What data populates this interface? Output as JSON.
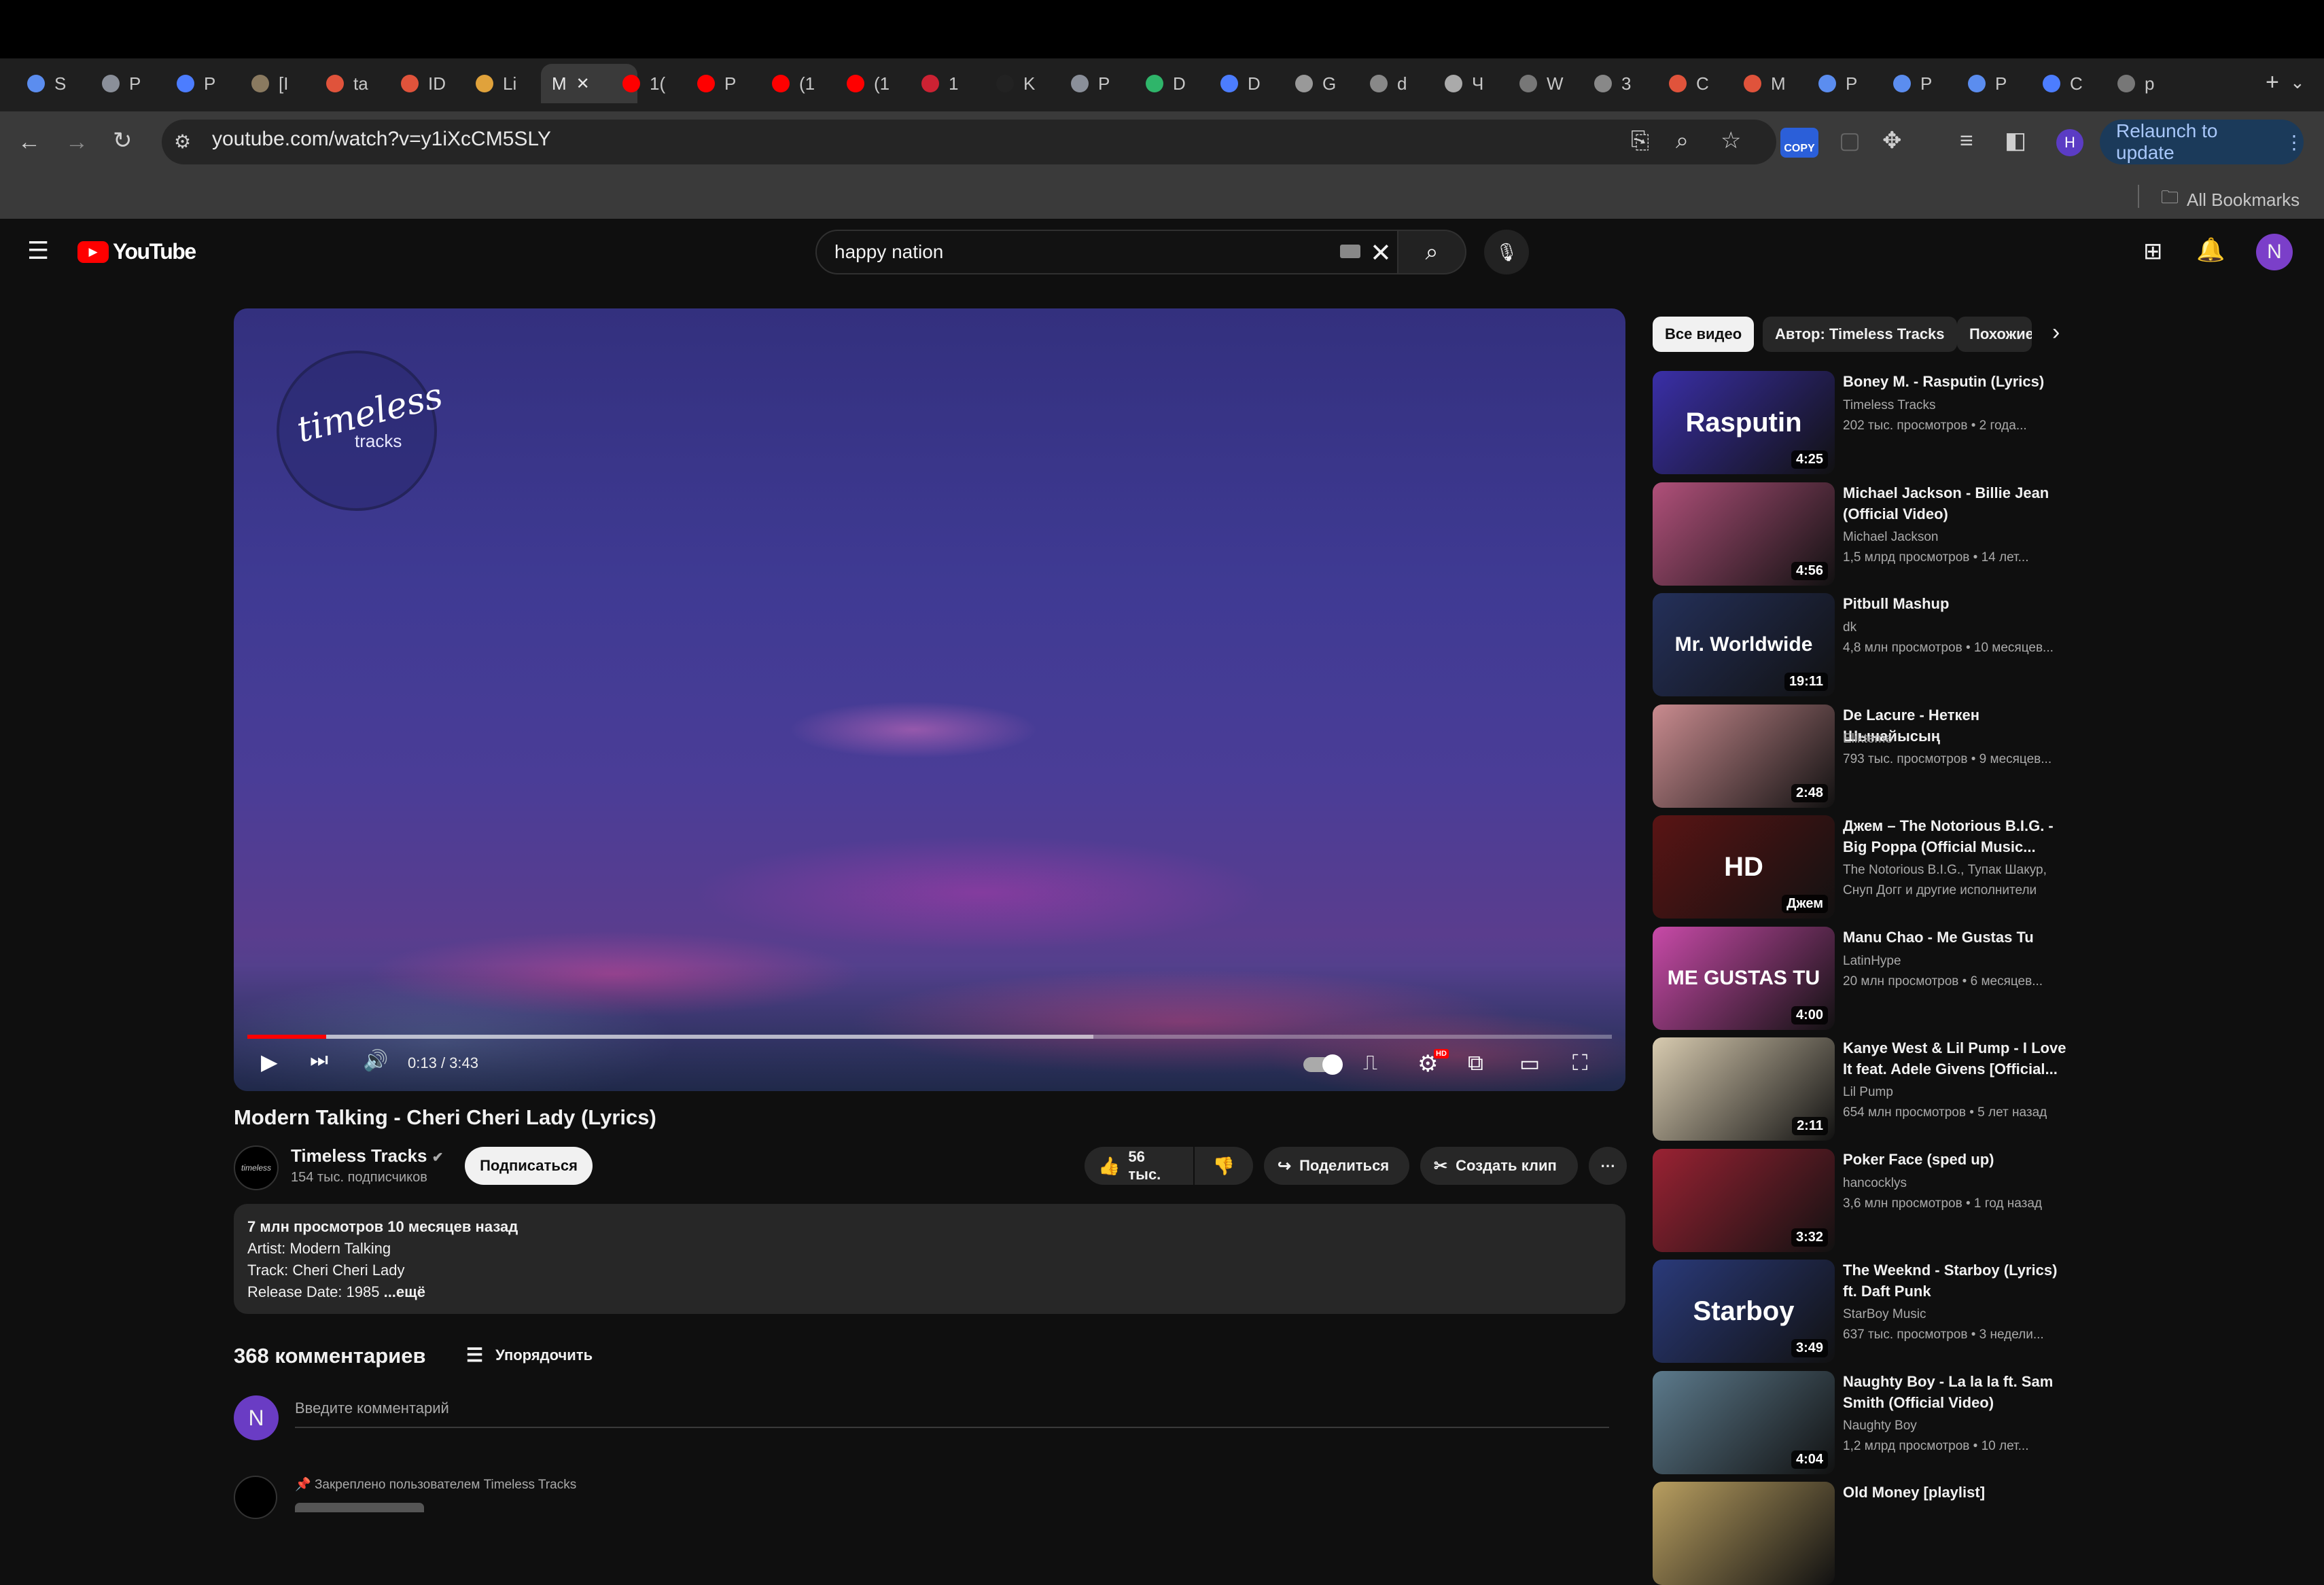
{
  "browser": {
    "tabs": [
      {
        "label": "S"
      },
      {
        "label": "P"
      },
      {
        "label": "P"
      },
      {
        "label": "[I"
      },
      {
        "label": "ta"
      },
      {
        "label": "ID"
      },
      {
        "label": "Li"
      },
      {
        "label": "M"
      },
      {
        "label": "1("
      },
      {
        "label": "P"
      },
      {
        "label": "(1"
      },
      {
        "label": "(1"
      },
      {
        "label": "1"
      },
      {
        "label": "K"
      },
      {
        "label": "P"
      },
      {
        "label": "D"
      },
      {
        "label": "D"
      },
      {
        "label": "G"
      },
      {
        "label": "d"
      },
      {
        "label": "Ч"
      },
      {
        "label": "W"
      },
      {
        "label": "3"
      },
      {
        "label": "C"
      },
      {
        "label": "M"
      },
      {
        "label": "P"
      },
      {
        "label": "P"
      },
      {
        "label": "P"
      },
      {
        "label": "C"
      },
      {
        "label": "p"
      }
    ],
    "url": "youtube.com/watch?v=y1iXcCM5SLY",
    "relaunch_label": "Relaunch to update",
    "profile_initial": "H",
    "copy_badge": "COPY",
    "all_bookmarks": "All Bookmarks"
  },
  "youtube": {
    "logo_text": "YouTube",
    "search_value": "happy nation",
    "avatar_initial": "N"
  },
  "player": {
    "overlay_logo_main": "timeless",
    "overlay_logo_sub": "tracks",
    "time_current": "0:13",
    "time_total": "3:43",
    "played_fraction": 0.058,
    "buffered_fraction": 0.62,
    "hd_badge": "HD"
  },
  "video": {
    "title": "Modern Talking - Cheri Cheri Lady (Lyrics)",
    "channel": "Timeless Tracks",
    "subscribers": "154 тыс. подписчиков",
    "subscribe_label": "Подписаться",
    "likes": "56 тыс.",
    "share_label": "Поделиться",
    "clip_label": "Создать клип",
    "desc_stats": "7 млн просмотров  10 месяцев назад",
    "desc_lines": [
      "Artist: Modern Talking",
      "Track: Cheri Cheri Lady",
      "Release Date: 1985"
    ],
    "desc_more": " ...ещё"
  },
  "comments": {
    "count_label": "368 комментариев",
    "sort_label": "Упорядочить",
    "input_placeholder": "Введите комментарий",
    "user_initial": "N",
    "pinned_label": "Закреплено пользователем Timeless Tracks"
  },
  "sidebar": {
    "chips": [
      "Все видео",
      "Автор: Timeless Tracks",
      "Похожие"
    ],
    "recommendations": [
      {
        "title": "Boney M. - Rasputin (Lyrics)",
        "channel": "Timeless Tracks",
        "meta": "202 тыс. просмотров  • 2 года...",
        "duration": "4:25",
        "thumb_text": "Rasputin",
        "thumb_color": "#3a2fa8"
      },
      {
        "title": "Michael Jackson - Billie Jean (Official Video)",
        "channel": "Michael Jackson",
        "meta": "1,5 млрд просмотров  • 14 лет...",
        "duration": "4:56",
        "thumb_text": "",
        "thumb_color": "#b0507a"
      },
      {
        "title": "Pitbull Mashup",
        "channel": "dk",
        "meta": "4,8 млн просмотров  • 10 месяцев...",
        "duration": "19:11",
        "thumb_text": "Mr. Worldwide",
        "thumb_color": "#24305a"
      },
      {
        "title": "De Lacure - Неткен Шынайысың",
        "channel": "Elikteme",
        "meta": "793 тыс. просмотров  • 9 месяцев...",
        "duration": "2:48",
        "thumb_text": "",
        "thumb_color": "#c98b8f"
      },
      {
        "title": "Джем – The Notorious B.I.G. - Big Poppa (Official Music...",
        "channel": "The Notorious B.I.G., Тупак Шакур, Снуп Догг и другие исполнители",
        "meta": "",
        "duration": "Джем",
        "thumb_text": "HD",
        "thumb_color": "#5a1414"
      },
      {
        "title": "Manu Chao - Me Gustas Tu",
        "channel": "LatinHype",
        "meta": "20 млн просмотров  • 6 месяцев...",
        "duration": "4:00",
        "thumb_text": "ME GUSTAS TU",
        "thumb_color": "#c84aa8"
      },
      {
        "title": "Kanye West & Lil Pump - I Love It feat. Adele Givens [Official...",
        "channel": "Lil Pump",
        "meta": "654 млн просмотров  • 5 лет назад",
        "duration": "2:11",
        "thumb_text": "",
        "thumb_color": "#d8cbb0"
      },
      {
        "title": "Poker Face (sped up)",
        "channel": "hancocklys",
        "meta": "3,6 млн просмотров  • 1 год назад",
        "duration": "3:32",
        "thumb_text": "",
        "thumb_color": "#9a2233"
      },
      {
        "title": "The Weeknd - Starboy (Lyrics) ft. Daft Punk",
        "channel": "StarBoy Music",
        "meta": "637 тыс. просмотров  • 3 недели...",
        "duration": "3:49",
        "thumb_text": "Starboy",
        "thumb_color": "#2a3a7a"
      },
      {
        "title": "Naughty Boy - La la la ft. Sam Smith (Official Video)",
        "channel": "Naughty Boy",
        "meta": "1,2 млрд просмотров  • 10 лет...",
        "duration": "4:04",
        "thumb_text": "",
        "thumb_color": "#5c7a8c"
      },
      {
        "title": "Old Money [playlist]",
        "channel": "",
        "meta": "",
        "duration": "",
        "thumb_text": "",
        "thumb_color": "#b89e60"
      }
    ]
  }
}
